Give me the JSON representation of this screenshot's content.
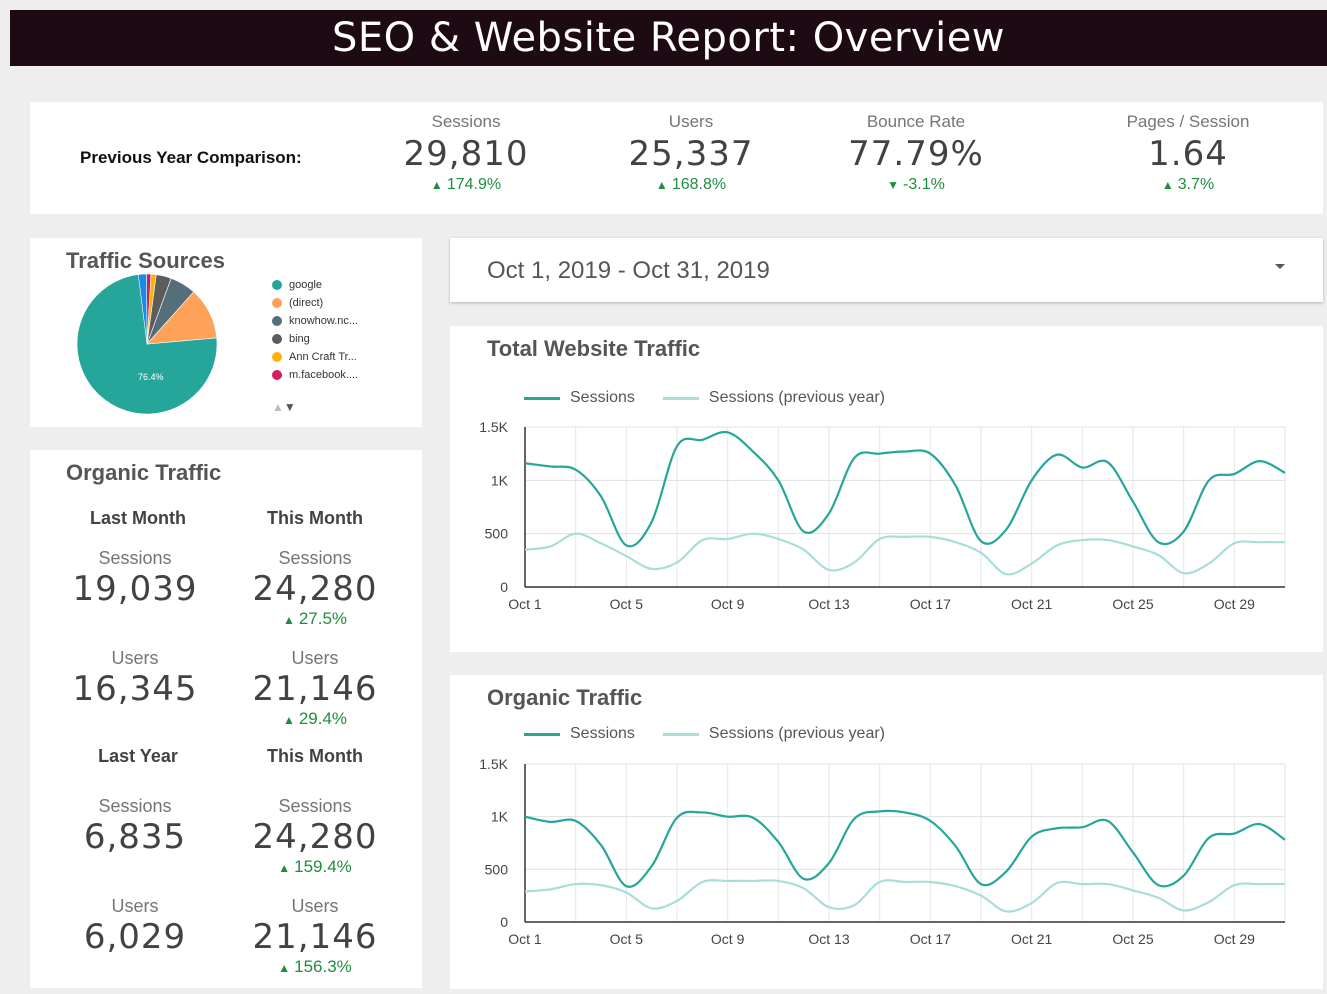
{
  "header": {
    "title": "SEO & Website Report: Overview"
  },
  "kpis": {
    "label": "Previous Year Comparison:",
    "items": [
      {
        "label": "Sessions",
        "value": "29,810",
        "change": "174.9%",
        "direction": "up"
      },
      {
        "label": "Users",
        "value": "25,337",
        "change": "168.8%",
        "direction": "up"
      },
      {
        "label": "Bounce Rate",
        "value": "77.79%",
        "change": "-3.1%",
        "direction": "down"
      },
      {
        "label": "Pages / Session",
        "value": "1.64",
        "change": "3.7%",
        "direction": "up"
      }
    ]
  },
  "traffic_sources": {
    "title": "Traffic Sources",
    "slice_label": "76.4%",
    "legend": [
      {
        "name": "google",
        "color": "#26a69a"
      },
      {
        "name": "(direct)",
        "color": "#ffa259"
      },
      {
        "name": "knowhow.nc...",
        "color": "#546e7a"
      },
      {
        "name": "bing",
        "color": "#5c5c5c"
      },
      {
        "name": "Ann Craft Tr...",
        "color": "#ffb300"
      },
      {
        "name": "m.facebook....",
        "color": "#d81b60"
      }
    ]
  },
  "organic": {
    "title": "Organic Traffic",
    "sections": [
      {
        "left_head": "Last Month",
        "right_head": "This Month",
        "rows": [
          {
            "label": "Sessions",
            "left": "19,039",
            "right": "24,280",
            "change": "27.5%"
          },
          {
            "label": "Users",
            "left": "16,345",
            "right": "21,146",
            "change": "29.4%"
          }
        ]
      },
      {
        "left_head": "Last Year",
        "right_head": "This Month",
        "rows": [
          {
            "label": "Sessions",
            "left": "6,835",
            "right": "24,280",
            "change": "159.4%"
          },
          {
            "label": "Users",
            "left": "6,029",
            "right": "21,146",
            "change": "156.3%"
          }
        ]
      }
    ]
  },
  "date_range": {
    "value": "Oct 1, 2019 - Oct 31, 2019"
  },
  "colors": {
    "current": "#26a69a",
    "previous": "#a7ded8",
    "positive": "#1e8e3e"
  },
  "chart_data": [
    {
      "type": "line",
      "title": "Total Website Traffic",
      "x": [
        "Oct 1",
        "Oct 2",
        "Oct 3",
        "Oct 4",
        "Oct 5",
        "Oct 6",
        "Oct 7",
        "Oct 8",
        "Oct 9",
        "Oct 10",
        "Oct 11",
        "Oct 12",
        "Oct 13",
        "Oct 14",
        "Oct 15",
        "Oct 16",
        "Oct 17",
        "Oct 18",
        "Oct 19",
        "Oct 20",
        "Oct 21",
        "Oct 22",
        "Oct 23",
        "Oct 24",
        "Oct 25",
        "Oct 26",
        "Oct 27",
        "Oct 28",
        "Oct 29",
        "Oct 30",
        "Oct 31"
      ],
      "xticks": [
        "Oct 1",
        "Oct 5",
        "Oct 9",
        "Oct 13",
        "Oct 17",
        "Oct 21",
        "Oct 25",
        "Oct 29"
      ],
      "yticks": [
        "0",
        "500",
        "1K",
        "1.5K"
      ],
      "ylim": [
        0,
        1500
      ],
      "grid": true,
      "legend_position": "top-left",
      "series": [
        {
          "name": "Sessions",
          "values": [
            1160,
            1130,
            1100,
            850,
            390,
            610,
            1320,
            1380,
            1450,
            1270,
            1000,
            520,
            690,
            1210,
            1250,
            1270,
            1250,
            950,
            430,
            540,
            1000,
            1240,
            1120,
            1170,
            800,
            420,
            520,
            1000,
            1060,
            1180,
            1070
          ]
        },
        {
          "name": "Sessions (previous year)",
          "values": [
            350,
            380,
            500,
            410,
            290,
            170,
            230,
            440,
            450,
            500,
            450,
            350,
            160,
            230,
            450,
            470,
            470,
            420,
            320,
            120,
            220,
            390,
            440,
            440,
            380,
            300,
            130,
            220,
            410,
            420,
            420
          ]
        }
      ]
    },
    {
      "type": "line",
      "title": "Organic Traffic",
      "x": [
        "Oct 1",
        "Oct 2",
        "Oct 3",
        "Oct 4",
        "Oct 5",
        "Oct 6",
        "Oct 7",
        "Oct 8",
        "Oct 9",
        "Oct 10",
        "Oct 11",
        "Oct 12",
        "Oct 13",
        "Oct 14",
        "Oct 15",
        "Oct 16",
        "Oct 17",
        "Oct 18",
        "Oct 19",
        "Oct 20",
        "Oct 21",
        "Oct 22",
        "Oct 23",
        "Oct 24",
        "Oct 25",
        "Oct 26",
        "Oct 27",
        "Oct 28",
        "Oct 29",
        "Oct 30",
        "Oct 31"
      ],
      "xticks": [
        "Oct 1",
        "Oct 5",
        "Oct 9",
        "Oct 13",
        "Oct 17",
        "Oct 21",
        "Oct 25",
        "Oct 29"
      ],
      "yticks": [
        "0",
        "500",
        "1K",
        "1.5K"
      ],
      "ylim": [
        0,
        1500
      ],
      "grid": true,
      "legend_position": "top-left",
      "series": [
        {
          "name": "Sessions",
          "values": [
            1000,
            950,
            960,
            730,
            340,
            530,
            990,
            1040,
            1000,
            990,
            760,
            410,
            560,
            980,
            1050,
            1040,
            960,
            720,
            360,
            480,
            810,
            890,
            900,
            960,
            660,
            350,
            440,
            800,
            840,
            930,
            780
          ]
        },
        {
          "name": "Sessions (previous year)",
          "values": [
            290,
            310,
            360,
            350,
            280,
            130,
            200,
            380,
            390,
            390,
            390,
            320,
            140,
            160,
            380,
            380,
            380,
            340,
            250,
            100,
            180,
            370,
            360,
            360,
            300,
            230,
            110,
            190,
            350,
            360,
            360
          ]
        }
      ]
    }
  ]
}
